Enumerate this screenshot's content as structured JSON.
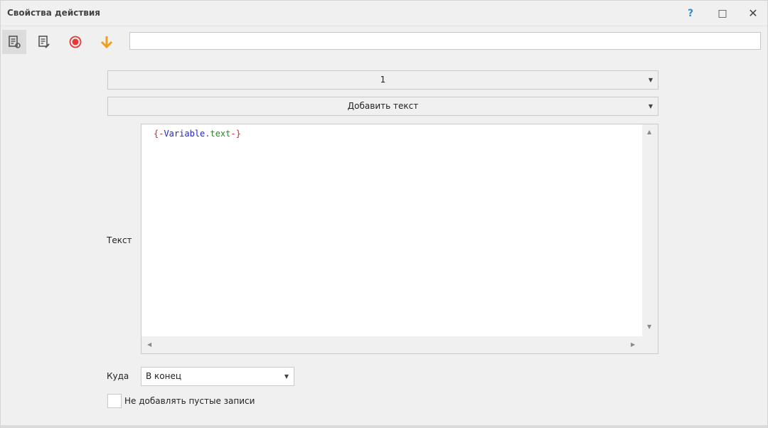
{
  "window": {
    "title": "Свойства действия",
    "help_label": "?",
    "maximize_label": "□",
    "close_label": "✕"
  },
  "toolbar": {
    "search_value": "",
    "icons": [
      "properties-icon",
      "edit-properties-icon",
      "record-icon",
      "arrow-down-icon"
    ]
  },
  "form": {
    "variant_value": "1",
    "add_text_label": "Добавить текст",
    "text_label": "Текст",
    "text_code": "{-Variable.text-}",
    "code_parts": {
      "open": "{-",
      "var": "Variable",
      "dot": ".",
      "prop": "text",
      "close": "-}"
    },
    "destination_label": "Куда",
    "destination_value": "В конец",
    "skip_empty_label": "Не добавлять пустые записи",
    "skip_empty_checked": false
  },
  "colors": {
    "accent_blue": "#2f8ad8",
    "record_red": "#e53935",
    "arrow_orange": "#f0a020",
    "code_red": "#d22",
    "code_blue": "#2222cc",
    "code_green": "#2a8a2a"
  }
}
